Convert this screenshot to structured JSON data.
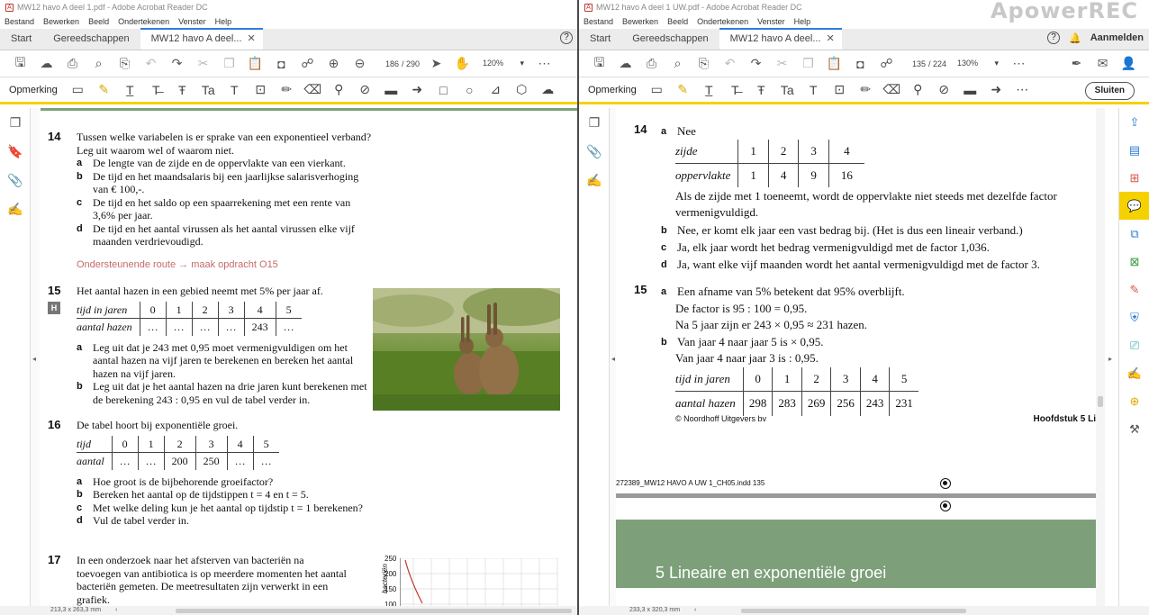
{
  "left": {
    "title": "MW12 havo A deel 1.pdf - Adobe Acrobat Reader DC",
    "menu": [
      "Bestand",
      "Bewerken",
      "Beeld",
      "Ondertekenen",
      "Venster",
      "Help"
    ],
    "tabs": [
      "Start",
      "Gereedschappen",
      "MW12 havo A deel..."
    ],
    "page_current": "186",
    "page_total": "/ 290",
    "zoom": "120%",
    "annot_label": "Opmerking",
    "status": "213,3 x 263,3 mm",
    "q14": {
      "num": "14",
      "text": "Tussen welke variabelen is er sprake van een exponentieel verband? Leg uit waarom wel of waarom niet.",
      "items": [
        {
          "l": "a",
          "t": "De lengte van de zijde en de oppervlakte van een vierkant."
        },
        {
          "l": "b",
          "t": "De tijd en het maandsalaris bij een jaarlijkse salarisverhoging van € 100,-."
        },
        {
          "l": "c",
          "t": "De tijd en het saldo op een spaarrekening met een rente van 3,6% per jaar."
        },
        {
          "l": "d",
          "t": "De tijd en het aantal virussen als het aantal virussen elke vijf maanden verdrievoudigd."
        }
      ]
    },
    "route": "Ondersteunende route → maak opdracht O15",
    "q15": {
      "num": "15",
      "badge": "H",
      "text": "Het aantal hazen in een gebied neemt met 5% per jaar af.",
      "table": [
        [
          "tijd in jaren",
          "0",
          "1",
          "2",
          "3",
          "4",
          "5"
        ],
        [
          "aantal hazen",
          "…",
          "…",
          "…",
          "…",
          "243",
          "…"
        ]
      ],
      "items": [
        {
          "l": "a",
          "t": "Leg uit dat je 243 met 0,95 moet vermenigvuldigen om het aantal hazen na vijf jaren te berekenen en bereken het aantal hazen na vijf jaren."
        },
        {
          "l": "b",
          "t": "Leg uit dat je het aantal hazen na drie jaren kunt berekenen met de berekening 243 : 0,95 en vul de tabel verder in."
        }
      ]
    },
    "q16": {
      "num": "16",
      "text": "De tabel hoort bij exponentiële groei.",
      "table": [
        [
          "tijd",
          "0",
          "1",
          "2",
          "3",
          "4",
          "5"
        ],
        [
          "aantal",
          "…",
          "…",
          "200",
          "250",
          "…",
          "…"
        ]
      ],
      "items": [
        {
          "l": "a",
          "t": "Hoe groot is de bijbehorende groeifactor?"
        },
        {
          "l": "b",
          "t": "Bereken het aantal op de tijdstippen t = 4 en t = 5."
        },
        {
          "l": "c",
          "t": "Met welke deling kun je het aantal op tijdstip t = 1 berekenen?"
        },
        {
          "l": "d",
          "t": "Vul de tabel verder in."
        }
      ]
    },
    "q17": {
      "num": "17",
      "text": "In een onderzoek naar het afsterven van bacteriën na toevoegen van antibiotica is op meerdere momenten het aantal bacteriën gemeten. De meetresultaten zijn verwerkt in een grafiek.",
      "ylabel": "bacteriën",
      "ticks": [
        "250",
        "200",
        "150",
        "100"
      ]
    }
  },
  "right": {
    "title": "MW12 havo A deel 1 UW.pdf - Adobe Acrobat Reader DC",
    "menu": [
      "Bestand",
      "Bewerken",
      "Beeld",
      "Ondertekenen",
      "Venster",
      "Help"
    ],
    "tabs": [
      "Start",
      "Gereedschappen",
      "MW12 havo A deel..."
    ],
    "signin": "Aanmelden",
    "page_current": "135",
    "page_total": "/ 224",
    "zoom": "130%",
    "annot_label": "Opmerking",
    "close_label": "Sluiten",
    "status": "233,3 x 320,3 mm",
    "a14": {
      "num": "14",
      "table": [
        [
          "zijde",
          "1",
          "2",
          "3",
          "4"
        ],
        [
          "oppervlakte",
          "1",
          "4",
          "9",
          "16"
        ]
      ],
      "a_label": "a",
      "a_head": "Nee",
      "a_text": "Als de zijde met 1 toeneemt, wordt de oppervlakte niet steeds met dezelfde factor vermenigvuldigd.",
      "items": [
        {
          "l": "b",
          "t": "Nee, er komt elk jaar een vast bedrag bij. (Het is dus een lineair verband.)"
        },
        {
          "l": "c",
          "t": "Ja, elk jaar wordt het bedrag vermenigvuldigd met de factor 1,036."
        },
        {
          "l": "d",
          "t": "Ja, want elke vijf maanden wordt het aantal vermenigvuldigd met de factor 3."
        }
      ]
    },
    "a15": {
      "num": "15",
      "a_lines": [
        "Een afname van 5% betekent dat 95% overblijft.",
        "De factor is 95 : 100 = 0,95.",
        "Na 5 jaar zijn er 243 × 0,95 ≈ 231 hazen."
      ],
      "b_lines": [
        "Van jaar 4 naar jaar 5 is × 0,95.",
        "Van jaar 4 naar jaar 3 is : 0,95."
      ],
      "table": [
        [
          "tijd in jaren",
          "0",
          "1",
          "2",
          "3",
          "4",
          "5"
        ],
        [
          "aantal hazen",
          "298",
          "283",
          "269",
          "256",
          "243",
          "231"
        ]
      ]
    },
    "copyright": "© Noordhoff Uitgevers bv",
    "chapter_footer": "Hoofdstuk 5 Li",
    "indd": "272389_MW12 HAVO A UW 1_CH05.indd   135",
    "chapter_title": "5   Lineaire en exponentiële groei"
  },
  "watermark": "ApowerREC"
}
